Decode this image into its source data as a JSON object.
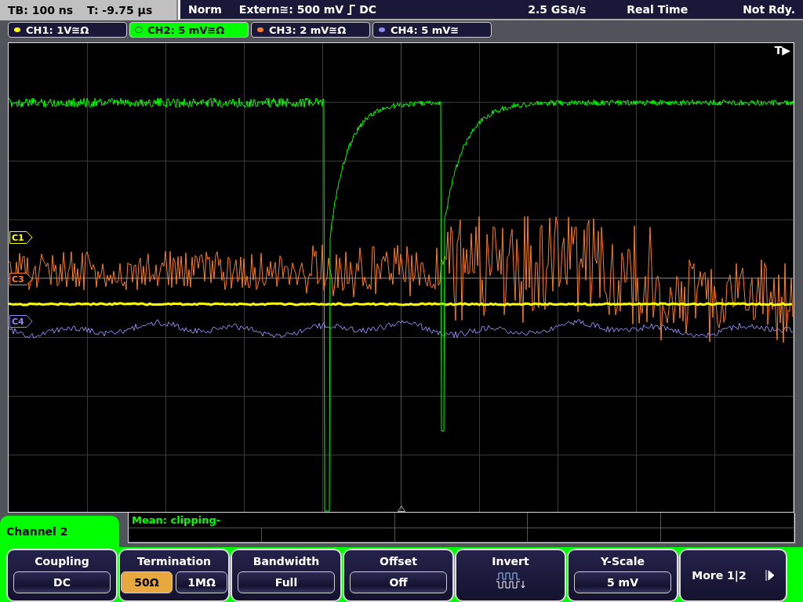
{
  "status_bar": {
    "timebase": "TB: 100 ns",
    "trigger_time": "T: -9.75 µs",
    "mode": "Norm",
    "trigger_source": "Extern≅: 500 mV",
    "trigger_coupling": "DC",
    "sample_rate": "2.5 GSa/s",
    "acquisition": "Real Time",
    "state": "Not Rdy."
  },
  "channels": [
    {
      "label": "CH1: 1V≅Ω",
      "color": "#ffff00",
      "selected": false
    },
    {
      "label": "CH2: 5 mV≅Ω",
      "color": "#00ff00",
      "selected": true
    },
    {
      "label": "CH3: 2 mV≅Ω",
      "color": "#ff7f27",
      "selected": false
    },
    {
      "label": "CH4: 5 mV≅",
      "color": "#8c8cf0",
      "selected": false
    }
  ],
  "display": {
    "trigger_marker": "T▶",
    "markers": [
      {
        "label": "C1",
        "color": "#ffff00"
      },
      {
        "label": "C3",
        "color": "#ff7f27"
      },
      {
        "label": "C4",
        "color": "#8c8cf0"
      }
    ]
  },
  "measurement": {
    "text": "Mean: clipping-"
  },
  "menu": {
    "title": "Channel 2",
    "softkeys": [
      {
        "kind": "value",
        "label": "Coupling",
        "value": "DC"
      },
      {
        "kind": "choice",
        "label": "Termination",
        "options": [
          {
            "label": "50Ω",
            "selected": true
          },
          {
            "label": "1MΩ",
            "selected": false
          }
        ]
      },
      {
        "kind": "value",
        "label": "Bandwidth",
        "value": "Full"
      },
      {
        "kind": "value",
        "label": "Offset",
        "value": "Off"
      },
      {
        "kind": "icon",
        "label": "Invert"
      },
      {
        "kind": "value",
        "label": "Y-Scale",
        "value": "5 mV"
      },
      {
        "kind": "more",
        "label": "More 1|2"
      }
    ]
  }
}
